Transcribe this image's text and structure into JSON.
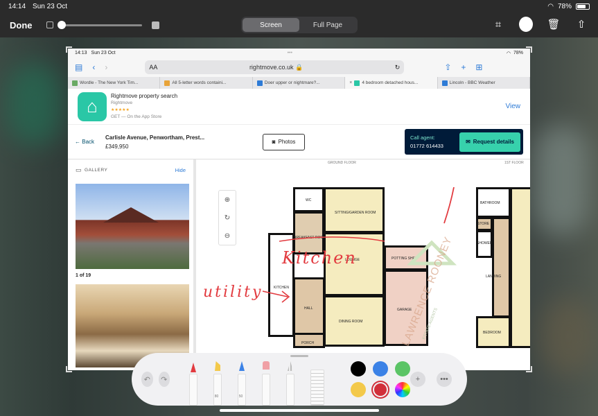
{
  "status_bar": {
    "time": "14:14",
    "date": "Sun 23 Oct",
    "battery": "78%"
  },
  "editor": {
    "done": "Done",
    "mode_screen": "Screen",
    "mode_full_page": "Full Page",
    "opacity_slider": 0.0
  },
  "screenshot": {
    "status": {
      "time": "14:13",
      "date": "Sun 23 Oct",
      "battery": "78%"
    },
    "browser": {
      "text_size": "AA",
      "url": "rightmove.co.uk",
      "tabs": [
        {
          "label": "Wordle - The New York Tim...",
          "color": "#6aaa64"
        },
        {
          "label": "All 5-letter words containi...",
          "color": "#e8a43a"
        },
        {
          "label": "Doer upper or nightmare?...",
          "color": "#2e7bd6"
        },
        {
          "label": "4 bedroom detached hous...",
          "color": "#2ac7a6"
        },
        {
          "label": "Lincoln - BBC Weather",
          "color": "#2e7bd6"
        }
      ]
    },
    "app_banner": {
      "title": "Rightmove property search",
      "developer": "Rightmove",
      "stars": "★★★★★",
      "store": "GET — On the App Store",
      "view": "View"
    },
    "listing": {
      "back": "Back",
      "address": "Carlisle Avenue, Penwortham, Prest...",
      "price": "£349,950",
      "photos": "Photos",
      "call_agent": "Call agent:",
      "phone": "01772 614433",
      "request": "Request details"
    },
    "gallery": {
      "heading": "GALLERY",
      "hide": "Hide",
      "count": "1 of 19"
    },
    "floorplan": {
      "ground_floor": "GROUND FLOOR",
      "first_floor": "1ST FLOOR",
      "rooms": {
        "wc": "WC",
        "sitting": "SITTING/GARDEN ROOM",
        "breakfast": "BREAKFAST ROOM",
        "lounge": "LOUNGE",
        "potting": "POTTING SHED",
        "kitchen": "KITCHEN",
        "hall": "HALL",
        "dining": "DINING ROOM",
        "garage": "GARAGE",
        "porch": "PORCH",
        "bathroom": "BATHROOM",
        "store": "STORE",
        "shower": "SHOWER ROOM",
        "landing": "LANDING",
        "bedroom": "BEDROOM"
      },
      "watermark": "LAWRENCE ROONEY",
      "watermark_sub": "ESTATE AGENTS",
      "annotation_kitchen": "Kitchen",
      "annotation_utility": "utility"
    }
  },
  "palette": {
    "pen_size_1": "80",
    "pen_size_2": "50",
    "colors": [
      "#000000",
      "#3b82e6",
      "#5bc466",
      "#f3c94a",
      "#d12f3a"
    ],
    "selected_color": "#d12f3a",
    "ink_red": "#e23a3f"
  }
}
